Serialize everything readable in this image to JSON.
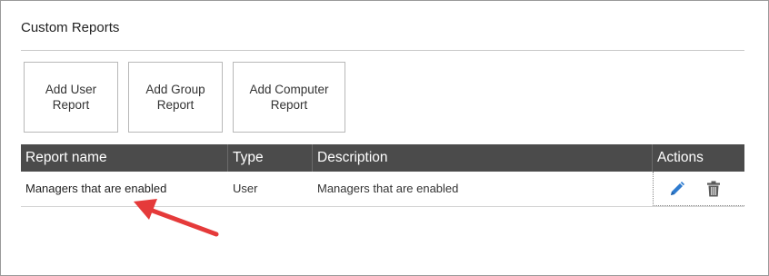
{
  "panel": {
    "title": "Custom Reports"
  },
  "buttons": {
    "add_user": "Add User\nReport",
    "add_group": "Add Group\nReport",
    "add_computer": "Add Computer\nReport"
  },
  "table": {
    "headers": {
      "name": "Report name",
      "type": "Type",
      "description": "Description",
      "actions": "Actions"
    },
    "rows": [
      {
        "name": "Managers that are enabled",
        "type": "User",
        "description": "Managers that are enabled"
      }
    ]
  },
  "icons": {
    "edit": "pencil-icon",
    "delete": "trash-icon"
  },
  "colors": {
    "header_bg": "#4b4b4b",
    "edit_icon": "#2e7bcf",
    "delete_icon": "#5a5a5a",
    "annotation_arrow": "#e53a3a"
  }
}
